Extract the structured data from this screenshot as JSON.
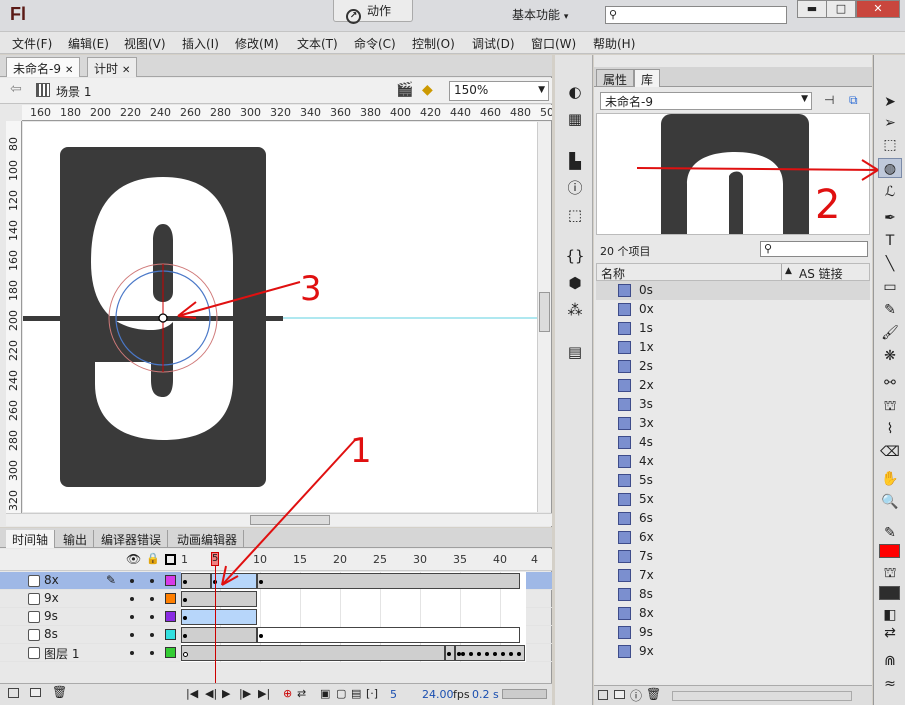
{
  "app": {
    "logo": "Fl",
    "action_label": "动作",
    "workspace": "基本功能"
  },
  "window_buttons": {
    "minimize": "▬",
    "maximize": "□",
    "close": "✕"
  },
  "menu": [
    "文件(F)",
    "编辑(E)",
    "视图(V)",
    "插入(I)",
    "修改(M)",
    "文本(T)",
    "命令(C)",
    "控制(O)",
    "调试(D)",
    "窗口(W)",
    "帮助(H)"
  ],
  "doc_tabs": [
    {
      "label": "未命名-9"
    },
    {
      "label": "计时"
    }
  ],
  "editbar": {
    "scene": "场景 1",
    "zoom": "150%"
  },
  "ruler_h": [
    "160",
    "180",
    "200",
    "220",
    "240",
    "260",
    "280",
    "300",
    "320",
    "340",
    "360",
    "380",
    "400",
    "420",
    "440",
    "460",
    "480",
    "50"
  ],
  "ruler_v": [
    "80",
    "100",
    "120",
    "140",
    "160",
    "180",
    "200",
    "220",
    "240",
    "260",
    "280",
    "300",
    "320"
  ],
  "stage": {
    "digit": "9"
  },
  "timeline": {
    "tabs": [
      "时间轴",
      "输出",
      "编译器错误",
      "动画编辑器"
    ],
    "frame_numbers": [
      "1",
      "5",
      "10",
      "15",
      "20",
      "25",
      "30",
      "35",
      "40",
      "4"
    ],
    "current_frame": "5",
    "layers": [
      {
        "name": "8x",
        "color": "#d63ae8"
      },
      {
        "name": "9x",
        "color": "#ff7f00"
      },
      {
        "name": "9s",
        "color": "#8a2be2"
      },
      {
        "name": "8s",
        "color": "#33e0e0"
      },
      {
        "name": "图层 1",
        "color": "#33cc33"
      }
    ],
    "footer": {
      "frame": "5",
      "fps": "24.00",
      "fps_unit": "fps",
      "time": "0.2 s"
    }
  },
  "library": {
    "tabs": [
      "属性",
      "库"
    ],
    "document": "未命名-9",
    "count": "20 个项目",
    "col_name": "名称",
    "col_link": "AS 链接",
    "items": [
      "0s",
      "0x",
      "1s",
      "1x",
      "2s",
      "2x",
      "3s",
      "3x",
      "4s",
      "4x",
      "5s",
      "5x",
      "6s",
      "6x",
      "7s",
      "7x",
      "8s",
      "8x",
      "9s",
      "9x"
    ]
  },
  "annotations": [
    "1",
    "2",
    "3"
  ],
  "colors": {
    "stroke": "#2d2d2d",
    "fill": "#ff0000",
    "annotation": "#e01010",
    "selected_layer": "#9fb8e6"
  }
}
